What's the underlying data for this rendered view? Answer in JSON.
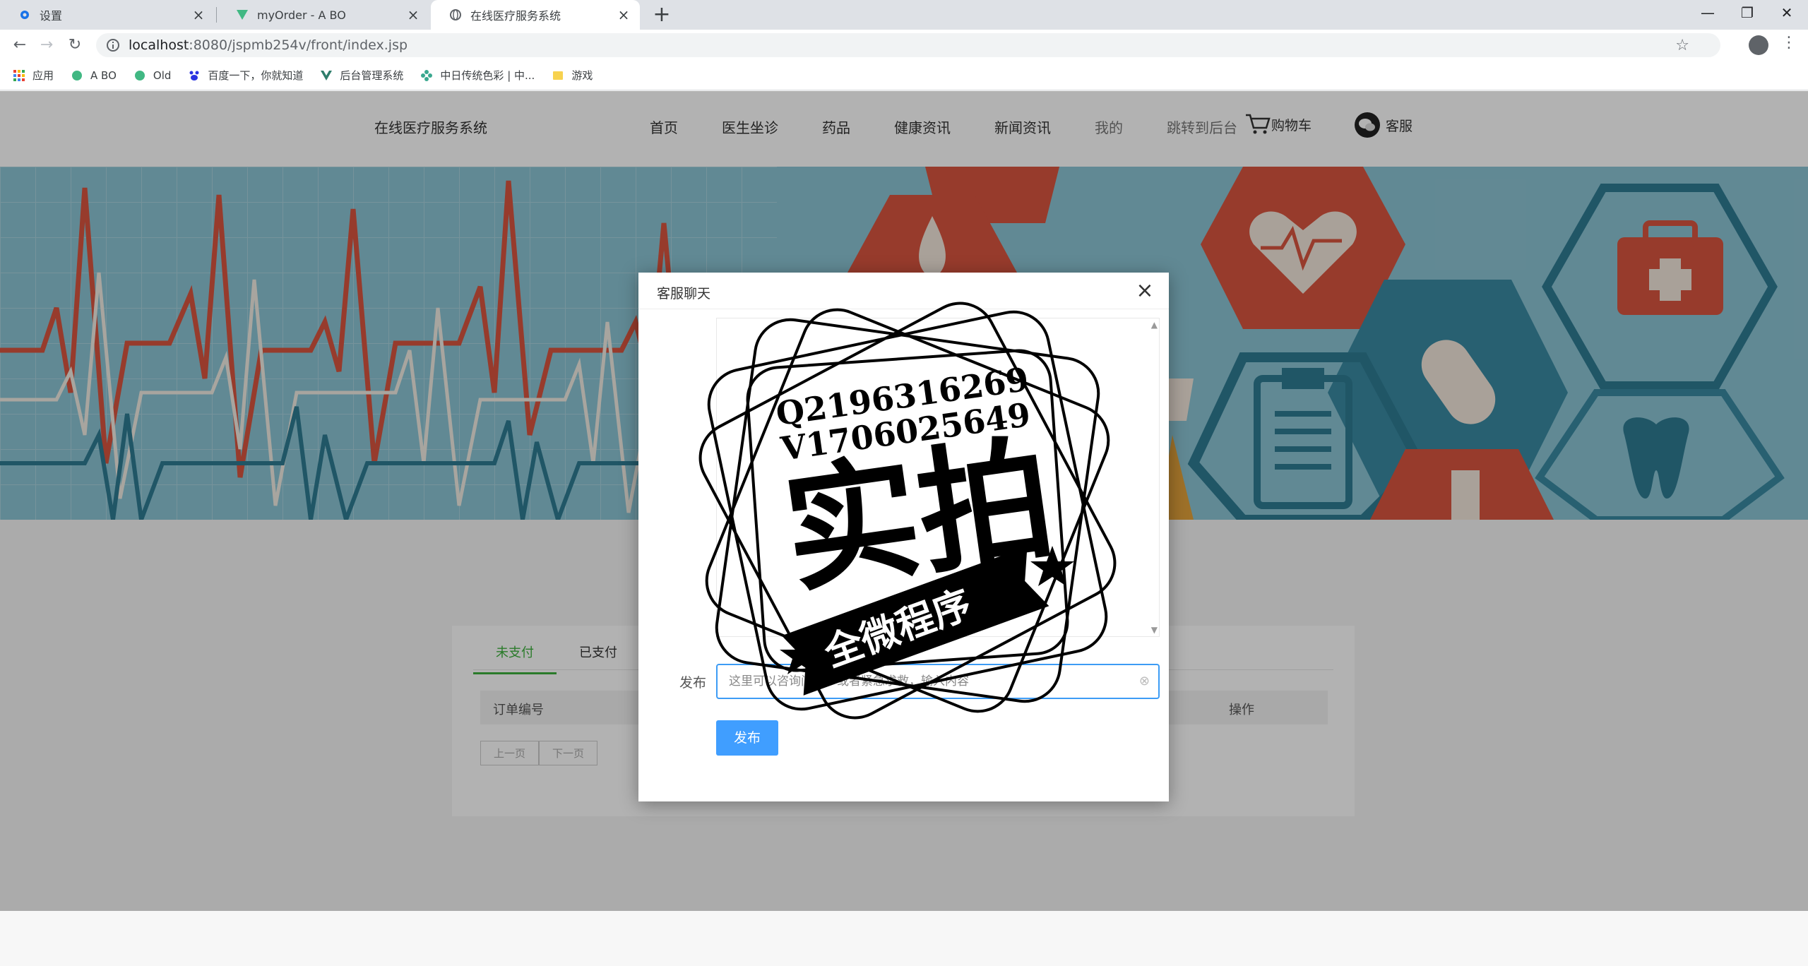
{
  "browser": {
    "tabs": [
      {
        "title": "设置",
        "icon": "gear-icon"
      },
      {
        "title": "myOrder - A BO",
        "icon": "vue-icon"
      },
      {
        "title": "在线医疗服务系统",
        "icon": "globe-icon"
      }
    ],
    "url_host": "localhost",
    "url_path": ":8080/jspmb254v/front/index.jsp",
    "bookmarks": [
      {
        "label": "应用",
        "icon": "apps-grid-icon"
      },
      {
        "label": "A BO",
        "icon": "vue-icon"
      },
      {
        "label": "Old",
        "icon": "vue-icon"
      },
      {
        "label": "百度一下，你就知道",
        "icon": "baidu-paw-icon"
      },
      {
        "label": "后台管理系统",
        "icon": "vue-v-icon"
      },
      {
        "label": "中日传统色彩 | 中...",
        "icon": "flower-icon"
      },
      {
        "label": "游戏",
        "icon": "folder-icon"
      }
    ]
  },
  "site": {
    "brand": "在线医疗服务系统",
    "nav": [
      "首页",
      "医生坐诊",
      "药品",
      "健康资讯",
      "新闻资讯",
      "我的",
      "跳转到后台"
    ],
    "cart_label": "购物车",
    "service_label": "客服"
  },
  "orders": {
    "tabs": [
      "未支付",
      "已支付"
    ],
    "col_order_no": "订单编号",
    "col_actions": "操作",
    "prev": "上一页",
    "next": "下一页"
  },
  "modal": {
    "title": "客服聊天",
    "post_label": "发布",
    "input_placeholder": "这里可以咨询问诊，或者紧急求救，输入内容",
    "post_button": "发布"
  },
  "watermark": {
    "line1": "Q2196316269",
    "line2": "V1706025649",
    "big": "实拍",
    "ribbon": "全微程序"
  },
  "colors": {
    "accent_green": "#3db13d",
    "button_blue": "#409eff",
    "banner_red": "#d9553f",
    "banner_teal": "#2f7b93"
  }
}
